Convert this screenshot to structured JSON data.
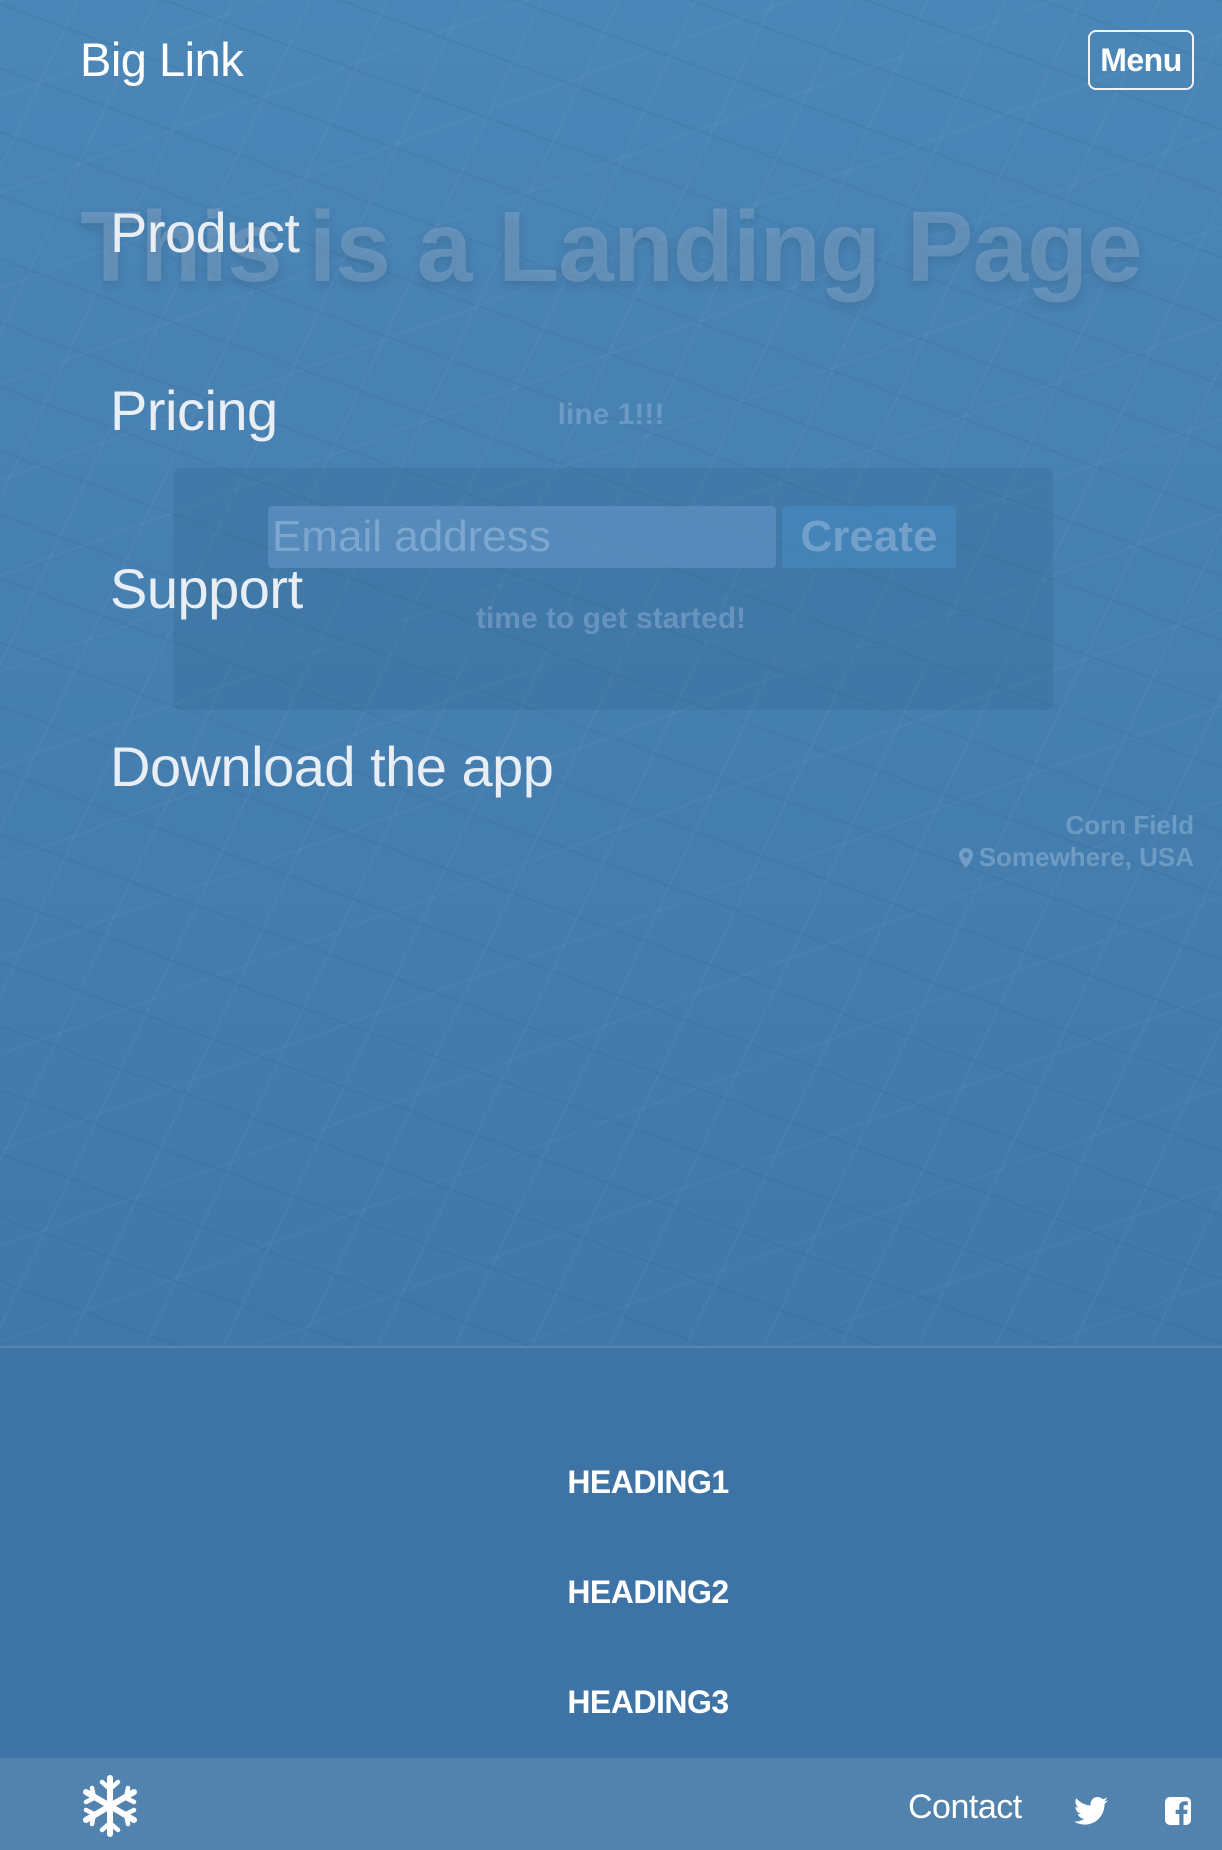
{
  "header": {
    "brand": "Big Link",
    "menu_label": "Menu"
  },
  "nav": {
    "items": [
      {
        "label": "Product"
      },
      {
        "label": "Pricing"
      },
      {
        "label": "Support"
      },
      {
        "label": "Download the app"
      }
    ]
  },
  "hero": {
    "title": "This is a Landing Page",
    "line": "line 1!!!",
    "email_placeholder": "Email address",
    "create_label": "Create",
    "start_text": "time to get started!",
    "caption_place": "Corn Field",
    "caption_location": "Somewhere, USA"
  },
  "footer": {
    "headings": [
      "HEADING1",
      "HEADING2",
      "HEADING3"
    ],
    "contact_label": "Contact",
    "icons": [
      "snowflake-icon",
      "twitter-icon",
      "facebook-icon"
    ]
  },
  "colors": {
    "background": "#3e74a5",
    "bottom_bar": "#5283ae",
    "text": "#ffffff"
  }
}
